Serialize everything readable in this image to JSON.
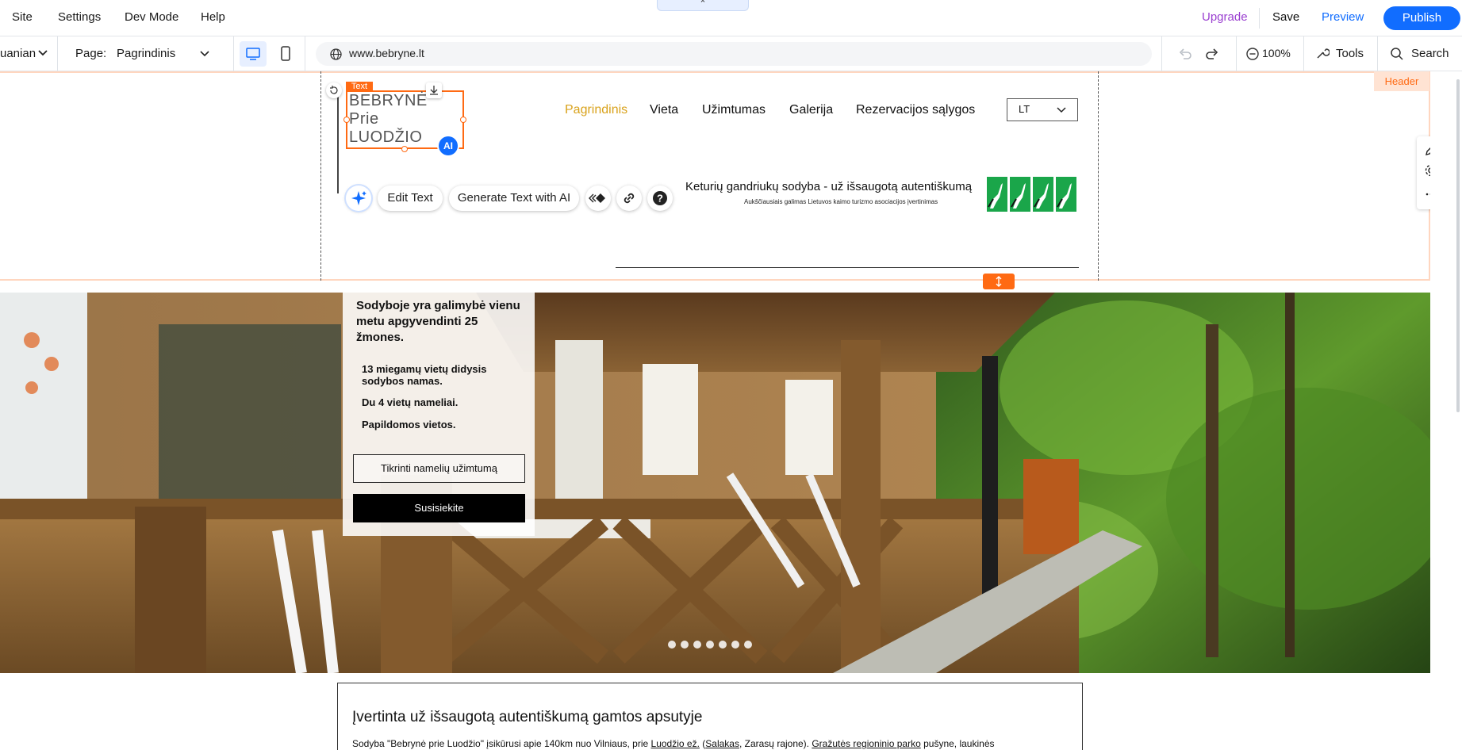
{
  "topbar": {
    "menu": [
      "Site",
      "Settings",
      "Dev Mode",
      "Help"
    ],
    "upgrade": "Upgrade",
    "save": "Save",
    "preview": "Preview",
    "publish": "Publish",
    "collapse_glyph": "⌃"
  },
  "secondbar": {
    "language": "uanian",
    "page_label": "Page:",
    "page_value": "Pagrindinis",
    "url": "www.bebryne.lt",
    "zoom": "100%",
    "tools": "Tools",
    "search": "Search"
  },
  "site": {
    "logo_lines": [
      "BEBRYNĖ",
      "Prie",
      "LUODŽIO"
    ],
    "text_tag": "Text",
    "ai_badge": "AI",
    "nav": [
      "Pagrindinis",
      "Vieta",
      "Užimtumas",
      "Galerija",
      "Rezervacijos sąlygos"
    ],
    "nav_active_color": "#d9a21b",
    "lang_select": "LT",
    "toolbar": {
      "edit_text": "Edit Text",
      "generate_ai": "Generate Text with AI"
    },
    "tagline": "Keturių gandriukų sodyba - už išsaugotą autentiškumą",
    "tagline_sub": "Aukščiausiais galimas Lietuvos kaimo turizmo asociacijos įvertinimas",
    "header_label": "Header"
  },
  "hero": {
    "headline": "Sodyboje yra galimybė vienu metu apgyvendinti 25 žmones.",
    "items": [
      "13 miegamų vietų didysis sodybos namas.",
      "Du 4 vietų nameliai.",
      "Papildomos vietos."
    ],
    "btn_check": "Tikrinti namelių užimtumą",
    "btn_contact": "Susisiekite",
    "slide_count": 7
  },
  "section": {
    "heading": "Įvertinta už išsaugotą autentiškumą gamtos apsutyje",
    "text_start": "Sodyba \"Bebrynė prie Luodžio\" įsikūrusi apie 140km nuo Vilniaus, prie ",
    "link1": "Luodžio ež.",
    "text_mid1": " (",
    "link2": "Salakas",
    "text_mid2": ", Zarasų rajone). ",
    "link3": "Gražutės regioninio parko",
    "text_end": " pušyne, laukinės"
  },
  "colors": {
    "accent": "#116dff",
    "upgrade": "#9a3fd0",
    "selection": "#ff6a13",
    "header_highlight": "#ffd6bf",
    "stork_green": "#1aa64a"
  }
}
